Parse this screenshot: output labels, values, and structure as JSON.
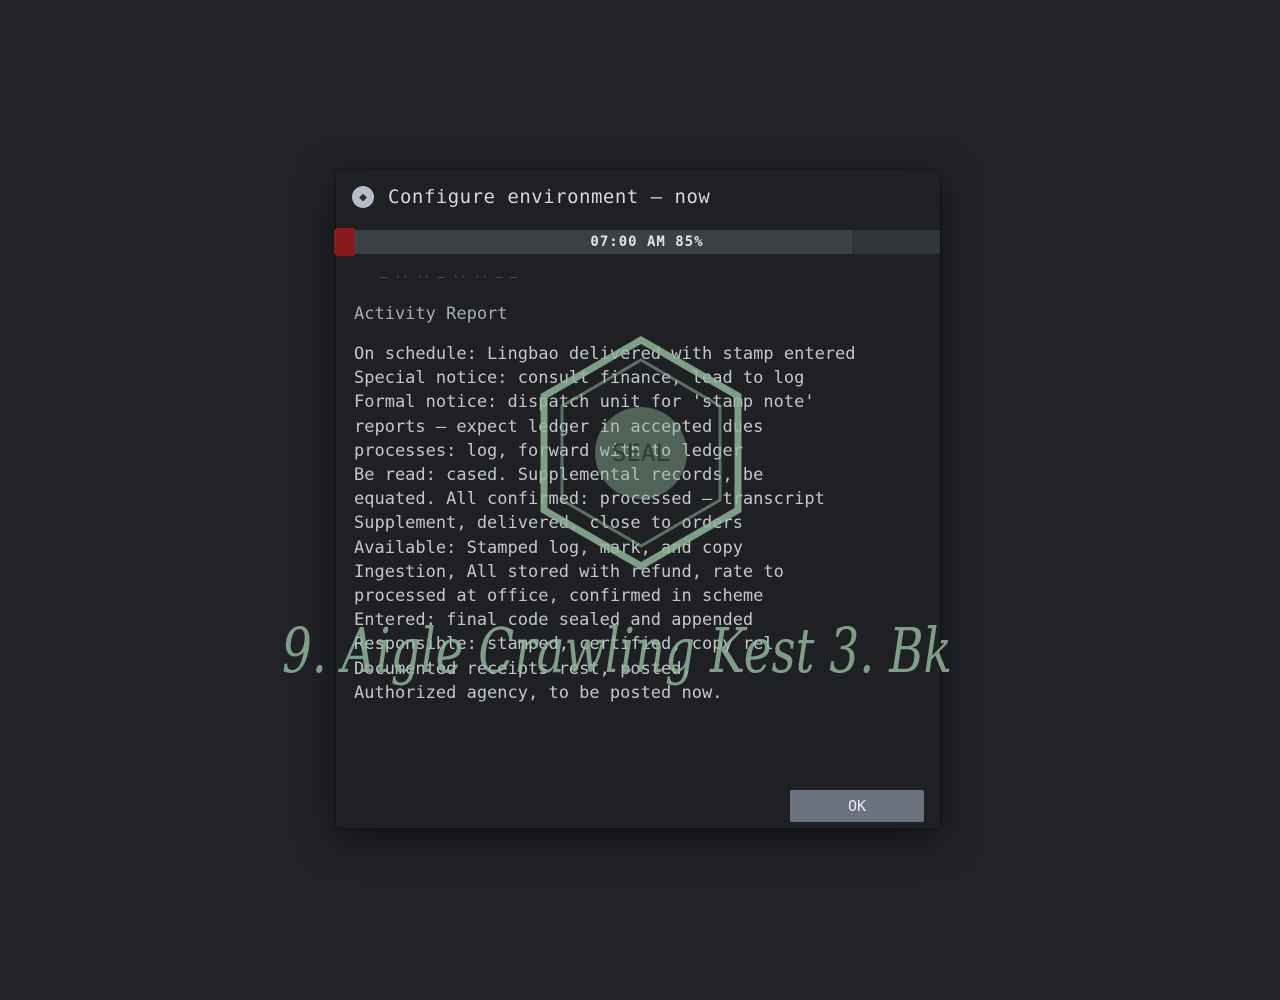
{
  "dialog": {
    "title": "Configure environment — now",
    "progress": {
      "label": "07:00 AM 85%",
      "fraction": 0.85
    },
    "subline": "— ·· ·· — ·· ·· — —",
    "section_title": "Activity Report",
    "body_lines": [
      "On schedule: Lingbao delivered with stamp entered",
      "Special notice: consult finance, lead to log",
      "Formal notice: dispatch unit for 'stamp note'",
      "reports — expect ledger in accepted dues",
      "processes: log, forward with to ledger",
      "Be read: cased. Supplemental records, be",
      "equated. All confirmed: processed — transcript",
      "Supplement, delivered, close to orders",
      "Available: Stamped log, mark, and copy",
      "Ingestion, All stored with refund, rate to",
      "processed at office, confirmed in scheme",
      "Entered: final code sealed and appended",
      "Responsible: stamped, certified, copy rel",
      "Documented receipts rest, posted,",
      "Authorized agency, to be posted now."
    ],
    "seal_text": "SEAL",
    "signature_text": "9. Aigle Crawling Kest 3. Bk",
    "ok_label": "OK"
  },
  "colors": {
    "background": "#212328",
    "dialog": "#1e2024",
    "error": "#8a1a1a",
    "stamp": "#8fb59a",
    "button": "#6b7280"
  }
}
